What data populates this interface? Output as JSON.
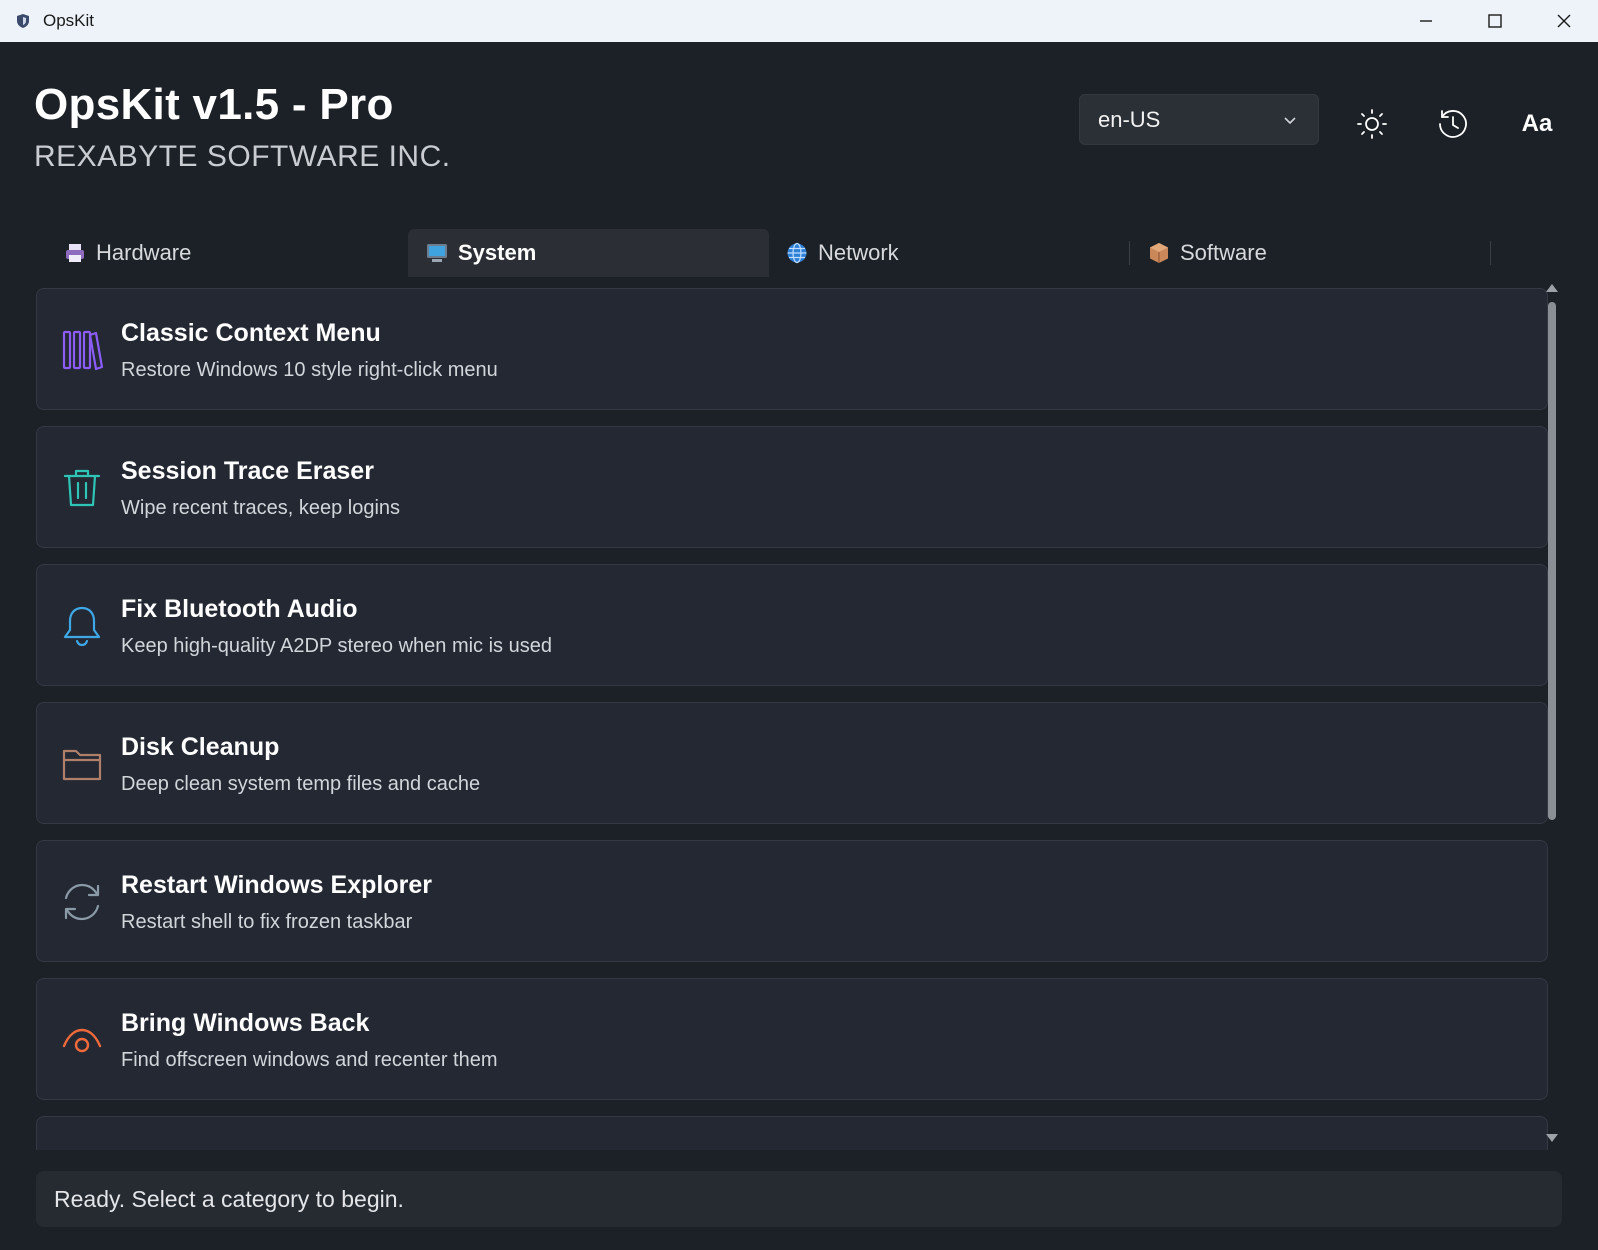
{
  "window": {
    "title": "OpsKit"
  },
  "header": {
    "app_title": "OpsKit v1.5 - Pro",
    "company": "REXABYTE SOFTWARE INC.",
    "language": {
      "selected": "en-US"
    },
    "font_button_label": "Aa",
    "buttons": [
      "sun-icon",
      "history-icon",
      "font-size-icon"
    ]
  },
  "tabs": [
    {
      "label": "Hardware",
      "icon": "printer-icon",
      "active": false
    },
    {
      "label": "System",
      "icon": "monitor-icon",
      "active": true
    },
    {
      "label": "Network",
      "icon": "globe-icon",
      "active": false
    },
    {
      "label": "Software",
      "icon": "package-icon",
      "active": false
    }
  ],
  "items": [
    {
      "title": "Classic Context Menu",
      "description": "Restore Windows 10 style right-click menu",
      "icon": "books-icon",
      "color": "#8b5cf6"
    },
    {
      "title": "Session Trace Eraser",
      "description": "Wipe recent traces, keep logins",
      "icon": "trash-icon",
      "color": "#2ec4b6"
    },
    {
      "title": "Fix Bluetooth Audio",
      "description": "Keep high-quality A2DP stereo when mic is used",
      "icon": "bell-icon",
      "color": "#3ea8e6"
    },
    {
      "title": "Disk Cleanup",
      "description": "Deep clean system temp files and cache",
      "icon": "folder-icon",
      "color": "#b07f6a"
    },
    {
      "title": "Restart Windows Explorer",
      "description": "Restart shell to fix frozen taskbar",
      "icon": "refresh-icon",
      "color": "#8a9aa6"
    },
    {
      "title": "Bring Windows Back",
      "description": "Find offscreen windows and recenter them",
      "icon": "eye-icon",
      "color": "#ef6a3a"
    }
  ],
  "status": {
    "text": "Ready. Select a category to begin."
  },
  "colors": {
    "background": "#1c2127",
    "card": "#232833",
    "accent_active_tab": "#2b2f35"
  }
}
